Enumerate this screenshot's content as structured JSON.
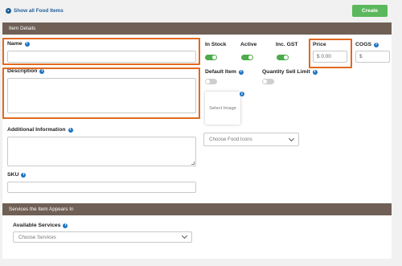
{
  "header": {
    "back_label": "Show all Food Items",
    "create_label": "Create"
  },
  "item_details": {
    "title": "Item Details",
    "name": {
      "label": "Name",
      "value": ""
    },
    "in_stock": {
      "label": "In Stock",
      "on": true
    },
    "active": {
      "label": "Active",
      "on": true
    },
    "inc_gst": {
      "label": "Inc. GST",
      "on": true
    },
    "price": {
      "label": "Price",
      "value": "$ 0.00"
    },
    "cogs": {
      "label": "COGS",
      "value": "$"
    },
    "description": {
      "label": "Description",
      "value": ""
    },
    "default_item": {
      "label": "Default Item",
      "on": false
    },
    "quantity_sell_limit": {
      "label": "Quantity Sell Limit",
      "on": false
    },
    "select_image_label": "Select Image",
    "food_icons_placeholder": "Choose Food Icons",
    "additional_information": {
      "label": "Additional Information",
      "value": ""
    },
    "sku": {
      "label": "SKU",
      "value": ""
    }
  },
  "services": {
    "title": "Services the Item Appears In",
    "available_label": "Available Services",
    "choose_placeholder": "Choose Services"
  },
  "colors": {
    "section_header": "#6f5f55",
    "create_button": "#5bb85c",
    "toggle_on": "#4cab4a",
    "highlight": "#e06a1f",
    "info_icon": "#1f74c4"
  }
}
